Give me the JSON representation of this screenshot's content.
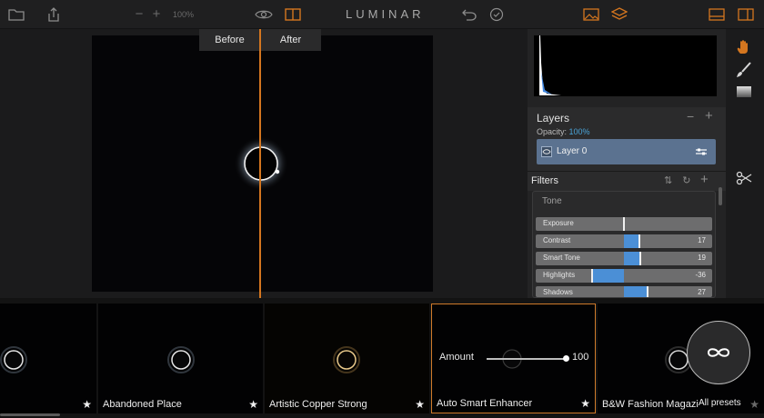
{
  "app": {
    "title": "LUMINAR"
  },
  "toolbar": {
    "zoom_value": "100%",
    "colors": {
      "accent": "#d4761f"
    }
  },
  "canvas": {
    "before_label": "Before",
    "after_label": "After"
  },
  "layers": {
    "title": "Layers",
    "opacity_label": "Opacity:",
    "opacity_value": "100%",
    "layer_name": "Layer 0"
  },
  "filters": {
    "title": "Filters",
    "section_title": "Tone",
    "sliders": [
      {
        "label": "Exposure",
        "value": "",
        "num": 0
      },
      {
        "label": "Contrast",
        "value": "17",
        "num": 17
      },
      {
        "label": "Smart Tone",
        "value": "19",
        "num": 19
      },
      {
        "label": "Highlights",
        "value": "-36",
        "num": -36
      },
      {
        "label": "Shadows",
        "value": "27",
        "num": 27
      }
    ]
  },
  "presets": {
    "items": [
      {
        "name": ""
      },
      {
        "name": "Abandoned Place"
      },
      {
        "name": "Artistic Copper Strong"
      },
      {
        "name": "Auto Smart Enhancer"
      },
      {
        "name": "B&W Fashion Magazi"
      }
    ],
    "amount_label": "Amount",
    "amount_value": "100",
    "all_presets_label": "All presets"
  }
}
